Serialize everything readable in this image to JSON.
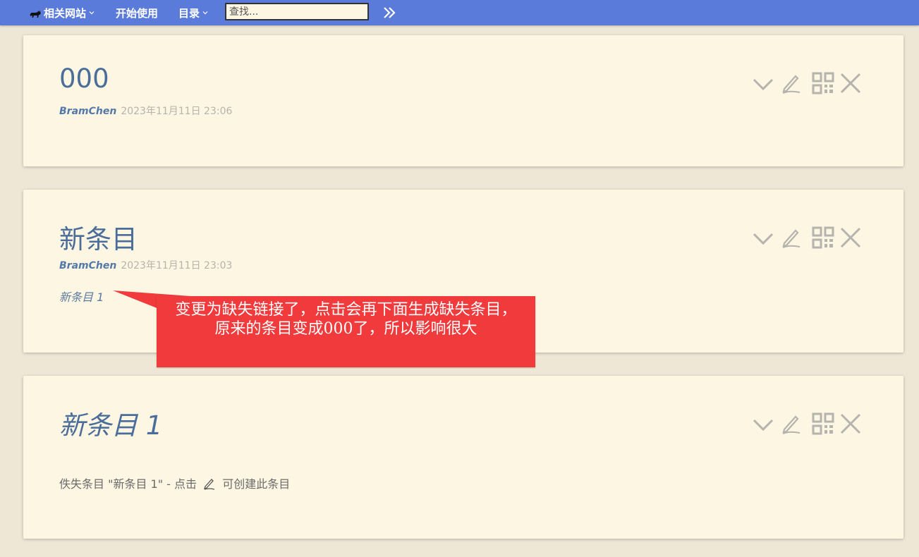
{
  "topbar": {
    "related_sites": "相关网站",
    "get_started": "开始使用",
    "contents": "目录",
    "search_placeholder": "查找...",
    "more_icon": "double-chevron-right-icon",
    "site_icon": "cat-icon",
    "bg_color": "#5b7bdb"
  },
  "tiddlers": [
    {
      "title": "000",
      "author": "BramChen",
      "date": "2023年11月11日 23:06"
    },
    {
      "title": "新条目",
      "author": "BramChen",
      "date": "2023年11月11日 23:03",
      "body_link": "新条目 1"
    },
    {
      "title": "新条目 1",
      "missing_prefix": "佚失条目 \"新条目 1\" - 点击",
      "missing_suffix": "可创建此条目"
    }
  ],
  "controls": {
    "icons": [
      "chevron-down-icon",
      "pencil-icon",
      "qr-code-icon",
      "close-icon"
    ],
    "color": "#b5b3ad"
  },
  "annotation": {
    "text": "变更为缺失链接了，点击会再下面生成缺失条目，原来的条目变成000了，所以影响很大",
    "color": "#f03a3c"
  }
}
